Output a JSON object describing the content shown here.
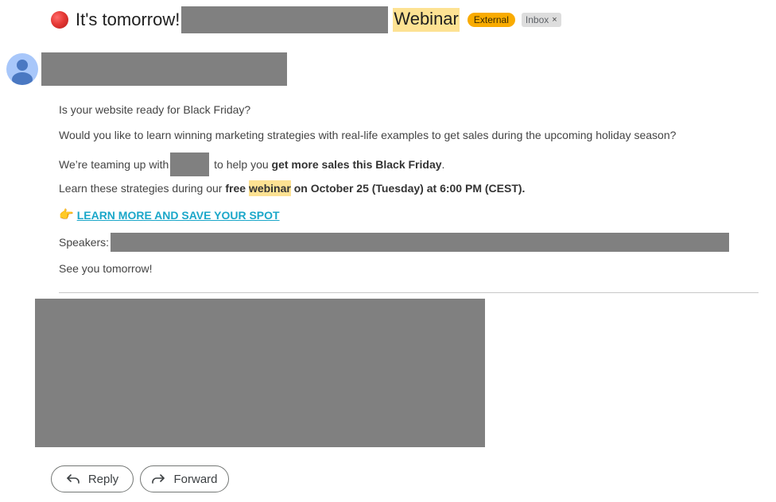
{
  "subject": {
    "prefix": "It's tomorrow!",
    "highlight": "Webinar",
    "labels": {
      "external": "External",
      "inbox": "Inbox",
      "inbox_close": "×"
    }
  },
  "body": {
    "line1": "Is your website ready for Black Friday?",
    "line2": "Would you like to learn winning marketing strategies with real-life examples to get sales during the upcoming holiday season?",
    "line3": {
      "pre": "We’re teaming up with",
      "mid": " to help you ",
      "bold": "get more sales this Black Friday",
      "post": "."
    },
    "line4": {
      "pre": "Learn these strategies during our ",
      "bold1": "free ",
      "highlight": "webinar",
      "bold2": " on October 25 (Tuesday) at 6:00 PM (CEST)."
    },
    "cta": {
      "emoji": "👉",
      "label": "LEARN MORE AND SAVE YOUR SPOT"
    },
    "speakers_label": "Speakers:",
    "closing": "See you tomorrow!"
  },
  "actions": {
    "reply": "Reply",
    "forward": "Forward"
  },
  "colors": {
    "highlight": "#fde293",
    "external_label": "#f9ab00",
    "link": "#1ba7c9",
    "redaction": "#808080",
    "avatar_bg": "#a8c7fa",
    "avatar_fg": "#4a78c2"
  },
  "icons": {
    "unread_dot": "red-circle-icon",
    "avatar": "person-icon",
    "reply": "reply-arrow-icon",
    "forward": "forward-arrow-icon"
  }
}
